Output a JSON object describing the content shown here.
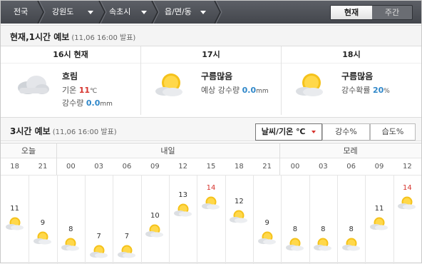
{
  "nav": {
    "crumbs": [
      "전국",
      "강원도",
      "속초시",
      "읍/면/동"
    ],
    "tabs": {
      "now": "현재",
      "week": "주간"
    }
  },
  "current": {
    "title": "현재,1시간 예보",
    "issued": "(11,06 16:00 발표)",
    "columns": [
      {
        "header": "16시 현재",
        "condition": "흐림",
        "icon": "cloudy-icon",
        "line1_label": "기온",
        "line1_value": "11",
        "line1_unit": "℃",
        "line2_label": "강수량",
        "line2_value": "0.0",
        "line2_unit": "mm"
      },
      {
        "header": "17시",
        "condition": "구름많음",
        "icon": "partly-cloudy-icon",
        "line1_label": "예상 강수량",
        "line1_value": "0.0",
        "line1_unit": "mm"
      },
      {
        "header": "18시",
        "condition": "구름많음",
        "icon": "partly-cloudy-icon",
        "line1_label": "강수확률",
        "line1_value": "20",
        "line1_unit": "%"
      }
    ]
  },
  "forecast3h": {
    "title": "3시간 예보",
    "issued": "(11,06 16:00 발표)",
    "buttons": [
      "날씨/기온 ℃",
      "강수%",
      "습도%"
    ],
    "days": [
      "오늘",
      "내일",
      "모레"
    ],
    "hours": [
      "18",
      "21",
      "00",
      "03",
      "06",
      "09",
      "12",
      "15",
      "18",
      "21",
      "00",
      "03",
      "06",
      "09",
      "12"
    ],
    "temps": [
      11,
      9,
      8,
      7,
      7,
      10,
      13,
      14,
      12,
      9,
      8,
      8,
      8,
      11,
      14
    ],
    "max_flags": [
      false,
      false,
      false,
      false,
      false,
      false,
      false,
      true,
      false,
      false,
      false,
      false,
      false,
      false,
      true
    ],
    "icons": [
      "partly-cloudy-icon",
      "partly-cloudy-icon",
      "partly-cloudy-icon",
      "partly-cloudy-icon",
      "partly-cloudy-icon",
      "partly-cloudy-icon",
      "partly-cloudy-icon",
      "partly-cloudy-icon",
      "partly-cloudy-icon",
      "partly-cloudy-icon",
      "partly-cloudy-icon",
      "partly-cloudy-icon",
      "partly-cloudy-icon",
      "partly-cloudy-icon",
      "partly-cloudy-icon"
    ]
  },
  "colors": {
    "max": "#d6342e",
    "accent": "#2f87c9"
  }
}
